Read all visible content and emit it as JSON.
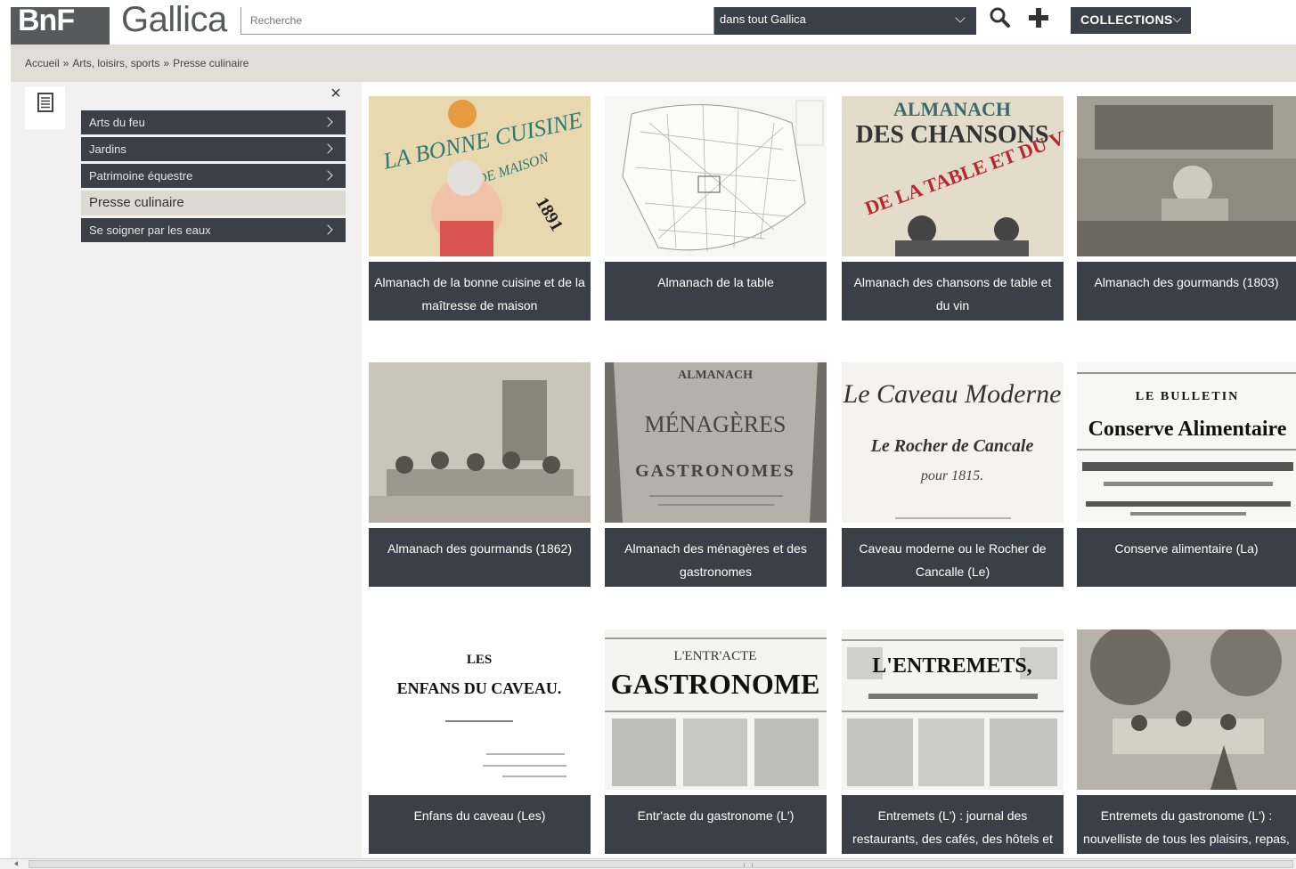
{
  "header": {
    "logo_mark": "BnF",
    "logo_text": "Gallica",
    "search_placeholder": "Recherche",
    "scope_label": "dans tout Gallica",
    "collections_label": "COLLECTIONS"
  },
  "breadcrumb": {
    "items": [
      "Accueil",
      "Arts, loisirs, sports",
      "Presse culinaire"
    ],
    "separator": "»"
  },
  "sidebar": {
    "close_glyph": "×",
    "items": [
      {
        "label": "Arts du feu",
        "active": false
      },
      {
        "label": "Jardins",
        "active": false
      },
      {
        "label": "Patrimoine équestre",
        "active": false
      },
      {
        "label": "Presse culinaire",
        "active": true
      },
      {
        "label": "Se soigner par les eaux",
        "active": false
      }
    ]
  },
  "cards": [
    {
      "title": "Almanach de la bonne cuisine et de la maîtresse de maison",
      "thumb_text": [
        "LA BONNE CUISINE",
        "DE MAISON",
        "1891"
      ]
    },
    {
      "title": "Almanach de la table",
      "thumb_text": []
    },
    {
      "title": "Almanach des chansons de table et du vin",
      "thumb_text": [
        "ALMANACH",
        "DES CHANSONS",
        "DE LA TABLE ET DU VIN"
      ]
    },
    {
      "title": "Almanach des gourmands (1803)",
      "thumb_text": []
    },
    {
      "title": "Almanach des gourmands (1862)",
      "thumb_text": []
    },
    {
      "title": "Almanach des ménagères et des gastronomes",
      "thumb_text": [
        "ALMANACH",
        "MÉNAGÈRES",
        "GASTRONOMES"
      ]
    },
    {
      "title": "Caveau moderne ou le Rocher de Cancalle (Le)",
      "thumb_text": [
        "Le Caveau Moderne",
        "Le Rocher de Cancale",
        "pour 1815."
      ]
    },
    {
      "title": "Conserve alimentaire (La)",
      "thumb_text": [
        "LE BULLETIN",
        "Conserve Alimentaire"
      ]
    },
    {
      "title": "Enfans du caveau (Les)",
      "thumb_text": [
        "LES",
        "ENFANS DU CAVEAU."
      ]
    },
    {
      "title": "Entr'acte du gastronome (L')",
      "thumb_text": [
        "L'ENTR'ACTE",
        "GASTRONOME"
      ]
    },
    {
      "title": "Entremets (L') : journal des restaurants, des cafés, des hôtels et des théâtres",
      "thumb_text": [
        "L'ENTREMETS,"
      ]
    },
    {
      "title": "Entremets du gastronome (L') : nouvelliste de tous les plaisirs, repas,",
      "thumb_text": []
    }
  ],
  "colors": {
    "dark": "#3b3f47",
    "logo_grey": "#58595b",
    "breadcrumb_bg": "#e0ded7",
    "panel_bg": "#f1f1f1",
    "active_item_bg": "#dcdad2"
  }
}
